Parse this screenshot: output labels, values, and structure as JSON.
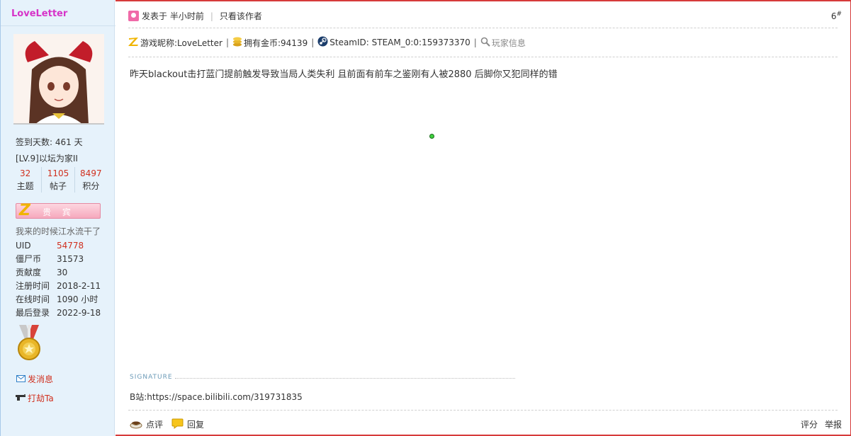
{
  "sidebar": {
    "username": "LoveLetter",
    "checkin": "签到天数: 461 天",
    "level": "[LV.9]以坛为家II",
    "stats": [
      {
        "num": "32",
        "label": "主题"
      },
      {
        "num": "1105",
        "label": "帖子"
      },
      {
        "num": "8497",
        "label": "积分"
      }
    ],
    "vip_label": "贵 宾",
    "motto": "我来的时候江水流干了",
    "profile": [
      {
        "key": "UID",
        "value": "54778"
      },
      {
        "key": "僵尸币",
        "value": "31573"
      },
      {
        "key": "贡献度",
        "value": "30"
      },
      {
        "key": "注册时间",
        "value": "2018-2-11"
      },
      {
        "key": "在线时间",
        "value": "1090 小时"
      },
      {
        "key": "最后登录",
        "value": "2022-9-18"
      }
    ],
    "send_message": "发消息",
    "rob": "打劫Ta"
  },
  "post": {
    "posted": "发表于 半小时前",
    "only_author": "只看该作者",
    "floor": "6",
    "floor_mark": "#",
    "nickname": "游戏昵称:LoveLetter",
    "coins": "拥有金币:94139",
    "steam": "SteamID: STEAM_0:0:159373370",
    "player_info": "玩家信息",
    "content": "昨天blackout击打蓝门提前触发导致当局人类失利 且前面有前车之鉴刚有人被2880 后脚你又犯同样的错",
    "signature_label": "SIGNATURE",
    "signature": "B站:https://space.bilibili.com/319731835",
    "comment": "点评",
    "reply": "回复",
    "rate": "评分",
    "report": "举报"
  }
}
